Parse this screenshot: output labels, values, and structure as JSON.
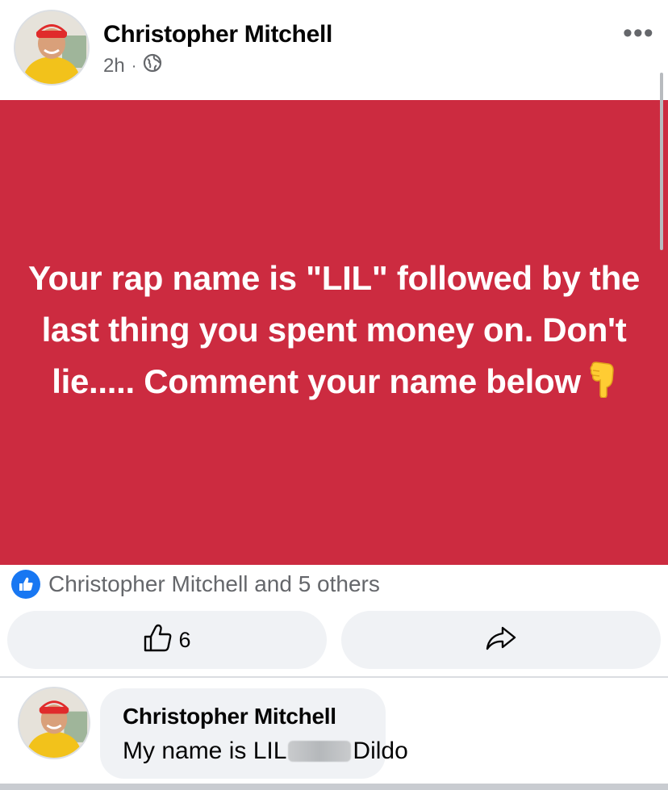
{
  "post": {
    "author": "Christopher Mitchell",
    "time": "2h",
    "separator": "·",
    "privacy_icon": "globe-icon",
    "menu_label": "•••",
    "background_color": "#cc2b40",
    "text": "Your rap name is \"LIL\" followed by the last thing you spent money on. Don't lie..... Comment your name below",
    "emoji_icon": "backhand-index-pointing-down-icon"
  },
  "reactions": {
    "text": "Christopher Mitchell and 5 others",
    "icon": "like-icon",
    "color": "#1877f2"
  },
  "actions": {
    "like_count": "6",
    "like_icon": "thumbs-up-outline-icon",
    "share_icon": "share-arrow-icon"
  },
  "comment": {
    "author": "Christopher Mitchell",
    "text_prefix": "My name is LIL",
    "text_suffix": "Dildo",
    "redacted": true
  }
}
